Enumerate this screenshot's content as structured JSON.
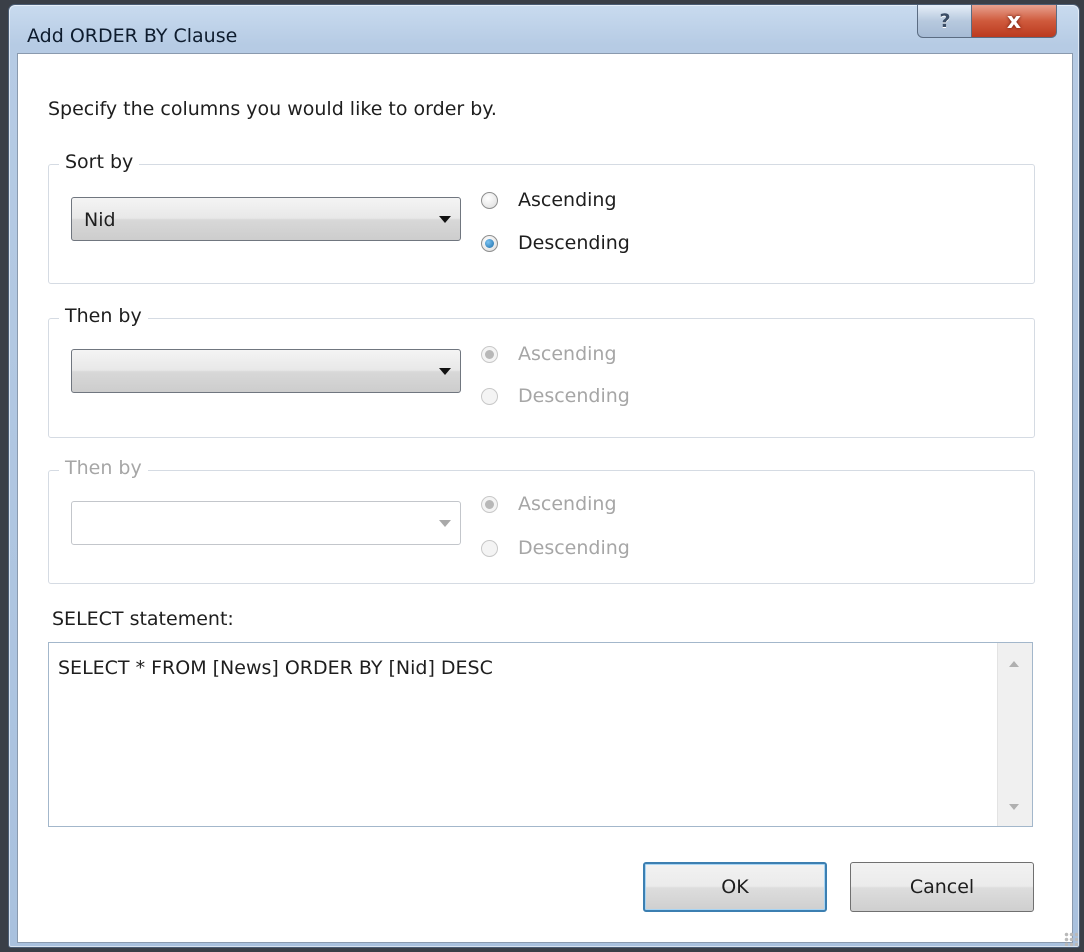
{
  "window": {
    "title": "Add ORDER BY Clause",
    "help_icon": "?",
    "close_icon": "x"
  },
  "prompt": "Specify the columns you would like to order by.",
  "groups": [
    {
      "legend": "Sort by",
      "column_value": "Nid",
      "enabled": true,
      "ascending_label": "Ascending",
      "descending_label": "Descending",
      "selected": "descending"
    },
    {
      "legend": "Then by",
      "column_value": "",
      "enabled": true,
      "ascending_label": "Ascending",
      "descending_label": "Descending",
      "selected": "ascending"
    },
    {
      "legend": "Then by",
      "column_value": "",
      "enabled": false,
      "ascending_label": "Ascending",
      "descending_label": "Descending",
      "selected": "ascending"
    }
  ],
  "select_statement": {
    "label": "SELECT statement:",
    "value": "SELECT * FROM [News] ORDER BY [Nid] DESC"
  },
  "buttons": {
    "ok": "OK",
    "cancel": "Cancel"
  }
}
